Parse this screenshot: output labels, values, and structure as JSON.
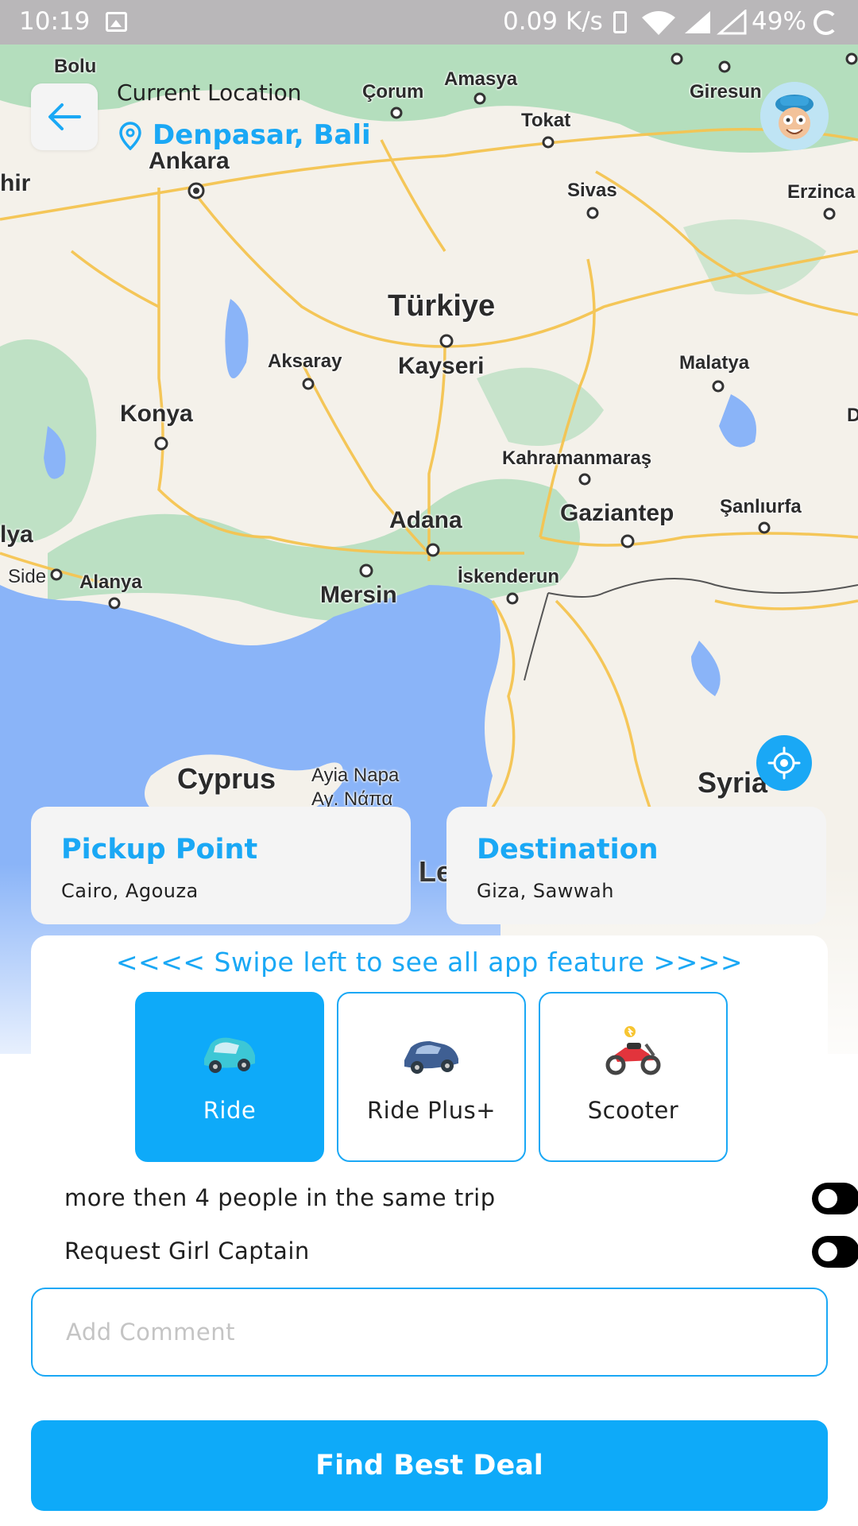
{
  "status_bar": {
    "time": "10:19",
    "network_speed": "0.09 K/s",
    "battery": "49%",
    "icons": [
      "image-icon",
      "phone-icon",
      "wifi-icon",
      "signal-icon",
      "battery-icon"
    ]
  },
  "map": {
    "labels": {
      "bolu": "Bolu",
      "amasya": "Amasya",
      "corum": "Çorum",
      "giresun": "Giresun",
      "tokat": "Tokat",
      "ankara": "Ankara",
      "hir": "hir",
      "sivas": "Sivas",
      "erzinca": "Erzinca",
      "turkiye": "Türkiye",
      "aksaray": "Aksaray",
      "kayseri": "Kayseri",
      "malatya": "Malatya",
      "d": "D",
      "konya": "Konya",
      "kahramanmaras": "Kahramanmaraş",
      "lya": "lya",
      "adana": "Adana",
      "gaziantep": "Gaziantep",
      "sanliurfa": "Şanlıurfa",
      "side": "Side",
      "alanya": "Alanya",
      "iskenderun": "İskenderun",
      "mersin": "Mersin",
      "cyprus": "Cyprus",
      "ayia_napa": "Ayia Napa",
      "ay_napa": "Αγ. Νάπα",
      "syria": "Syria",
      "le": "Le"
    },
    "colors": {
      "water": "#8ab4f8",
      "land": "#f4f1ea",
      "park": "#a8dab5",
      "road": "#f5c451"
    }
  },
  "header": {
    "current_location_label": "Current Location",
    "location_name": "Denpasar, Bali",
    "back_icon": "arrow-left-icon",
    "avatar_icon": "avatar"
  },
  "pickup": {
    "title": "Pickup Point",
    "value": "Cairo, Agouza"
  },
  "destination": {
    "title": "Destination",
    "value": "Giza, Sawwah"
  },
  "features": {
    "swipe_hint": "<<<< Swipe left to see all app feature >>>>",
    "items": [
      {
        "label": "Ride",
        "icon": "car-icon",
        "selected": true
      },
      {
        "label": "Ride Plus+",
        "icon": "car-plus-icon",
        "selected": false
      },
      {
        "label": "Scooter",
        "icon": "scooter-icon",
        "selected": false
      }
    ]
  },
  "options": {
    "more_people": {
      "label": "more then 4 people in the same trip",
      "enabled": false
    },
    "girl_captain": {
      "label": "Request Girl Captain",
      "enabled": false
    }
  },
  "comment": {
    "placeholder": "Add Comment",
    "value": ""
  },
  "cta": {
    "label": "Find Best Deal"
  },
  "accent_color": "#1aa8f5"
}
